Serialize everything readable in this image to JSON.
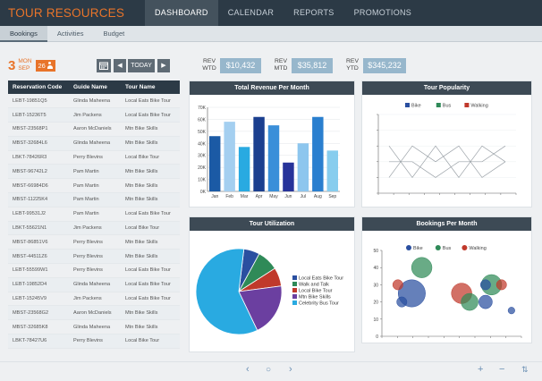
{
  "app": {
    "title": "TOUR RESOURCES"
  },
  "nav": [
    {
      "label": "DASHBOARD",
      "active": true
    },
    {
      "label": "CALENDAR"
    },
    {
      "label": "REPORTS"
    },
    {
      "label": "PROMOTIONS"
    }
  ],
  "subnav": [
    {
      "label": "Bookings",
      "active": true
    },
    {
      "label": "Activities"
    },
    {
      "label": "Budget"
    }
  ],
  "date": {
    "day": "3",
    "dow": "MON",
    "month": "SEP",
    "count": "26"
  },
  "controls": {
    "today": "TODAY",
    "prev": "<",
    "next": ">"
  },
  "revenue": [
    {
      "label": "REV\nWTD",
      "value": "$10,432"
    },
    {
      "label": "REV\nMTD",
      "value": "$35,812"
    },
    {
      "label": "REV\nYTD",
      "value": "$345,232"
    }
  ],
  "table": {
    "headers": [
      "Reservation Code",
      "Guide Name",
      "Tour Name"
    ],
    "rows": [
      [
        "LEBT-19851Q5",
        "Glinda Maheena",
        "Local Eats Bike Tour"
      ],
      [
        "LEBT-15236T5",
        "Jim Packens",
        "Local Eats Bike Tour"
      ],
      [
        "MBST-23568P1",
        "Aaron McDaniels",
        "Mtn Bike Skills"
      ],
      [
        "MBST-32684L6",
        "Glinda Maheena",
        "Mtn Bike Skills"
      ],
      [
        "LBKT-78426R3",
        "Perry Blevins",
        "Local Bike Tour"
      ],
      [
        "MBST-96742L2",
        "Pam Martin",
        "Mtn Bike Skills"
      ],
      [
        "MBST-66984D6",
        "Pam Martin",
        "Mtn Bike Skills"
      ],
      [
        "MBST-11225K4",
        "Pam Martin",
        "Mtn Bike Skills"
      ],
      [
        "LEBT-99531J2",
        "Pam Martin",
        "Local Eats Bike Tour"
      ],
      [
        "LBKT-55621N1",
        "Jim Packens",
        "Local Bike Tour"
      ],
      [
        "MBST-86851V6",
        "Perry Blevins",
        "Mtn Bike Skills"
      ],
      [
        "MBST-44511Z6",
        "Perry Blevins",
        "Mtn Bike Skills"
      ],
      [
        "LEBT-55599W1",
        "Perry Blevins",
        "Local Eats Bike Tour"
      ],
      [
        "LEBT-19852D4",
        "Glinda Maheena",
        "Local Eats Bike Tour"
      ],
      [
        "LEBT-15245V9",
        "Jim Packens",
        "Local Eats Bike Tour"
      ],
      [
        "MBST-23568G2",
        "Aaron McDaniels",
        "Mtn Bike Skills"
      ],
      [
        "MBST-32685K8",
        "Glinda Maheena",
        "Mtn Bike Skills"
      ],
      [
        "LBKT-78427U6",
        "Perry Blevins",
        "Local Bike Tour"
      ]
    ]
  },
  "charts": {
    "revenue": {
      "title": "Total Revenue Per Month"
    },
    "popularity": {
      "title": "Tour Popularity"
    },
    "utilization": {
      "title": "Tour Utilization"
    },
    "bookings": {
      "title": "Bookings Per Month"
    }
  },
  "chart_data": [
    {
      "type": "bar",
      "title": "Total Revenue Per Month",
      "categories": [
        "Jan",
        "Feb",
        "Mar",
        "Apr",
        "May",
        "Jun",
        "Jul",
        "Aug",
        "Sep"
      ],
      "values": [
        46,
        58,
        37,
        62,
        55,
        24,
        40,
        62,
        34
      ],
      "ylim": [
        0,
        70
      ],
      "yticks": [
        "0K",
        "10K",
        "20K",
        "30K",
        "40K",
        "50K",
        "60K",
        "70K"
      ],
      "colors": [
        "#1b5aa5",
        "#a4cff0",
        "#29aae1",
        "#1b3f8f",
        "#3a8fd9",
        "#27339a",
        "#8dc6ee",
        "#2a7fcf",
        "#87cdee"
      ]
    },
    {
      "type": "line",
      "title": "Tour Popularity",
      "series": [
        {
          "name": "Bike",
          "color": "#2a4fa0",
          "values": [
            3,
            1,
            3,
            1,
            3,
            2
          ]
        },
        {
          "name": "Bus",
          "color": "#2f8a58",
          "values": [
            1,
            3,
            2,
            3,
            1,
            2
          ]
        },
        {
          "name": "Walking",
          "color": "#c0392b",
          "values": [
            2,
            2,
            1,
            2,
            2,
            3
          ]
        }
      ],
      "ylim": [
        0,
        5
      ]
    },
    {
      "type": "pie",
      "title": "Tour Utilization",
      "slices": [
        {
          "label": "Local Eats Bike Tour",
          "value": 6,
          "color": "#2a4fa0"
        },
        {
          "label": "Walk and Talk",
          "value": 8,
          "color": "#2f8a58"
        },
        {
          "label": "Local Bike Tour",
          "value": 7,
          "color": "#c0392b"
        },
        {
          "label": "Mtn Bike Skills",
          "value": 20,
          "color": "#6b3fa0"
        },
        {
          "label": "Celebrity Bus Tour",
          "value": 59,
          "color": "#29aae1"
        }
      ]
    },
    {
      "type": "scatter",
      "title": "Bookings Per Month",
      "series": [
        {
          "name": "Bike",
          "color": "#2a4fa0"
        },
        {
          "name": "Bus",
          "color": "#2f8a58"
        },
        {
          "name": "Walking",
          "color": "#c0392b"
        }
      ],
      "points": [
        {
          "x": 1,
          "y": 2,
          "r": 3,
          "s": 0
        },
        {
          "x": 1.5,
          "y": 2.5,
          "r": 8,
          "s": 0
        },
        {
          "x": 2,
          "y": 4,
          "r": 6,
          "s": 1
        },
        {
          "x": 5.5,
          "y": 3,
          "r": 6,
          "s": 1
        },
        {
          "x": 4,
          "y": 2.5,
          "r": 6,
          "s": 2
        },
        {
          "x": 4.4,
          "y": 2,
          "r": 5,
          "s": 1
        },
        {
          "x": 5.2,
          "y": 2,
          "r": 4,
          "s": 0
        },
        {
          "x": 6,
          "y": 3,
          "r": 3,
          "s": 2
        },
        {
          "x": 5.2,
          "y": 3,
          "r": 3,
          "s": 0
        },
        {
          "x": 6.5,
          "y": 1.5,
          "r": 2,
          "s": 0
        },
        {
          "x": 0.8,
          "y": 3,
          "r": 3,
          "s": 2
        }
      ],
      "ylim": [
        0,
        5
      ],
      "yticks": [
        "0",
        "10",
        "20",
        "30",
        "40",
        "50"
      ]
    }
  ],
  "footer": {
    "prev": "‹",
    "home": "○",
    "next": "›",
    "plus": "+",
    "minus": "−",
    "sort": "⇅"
  }
}
